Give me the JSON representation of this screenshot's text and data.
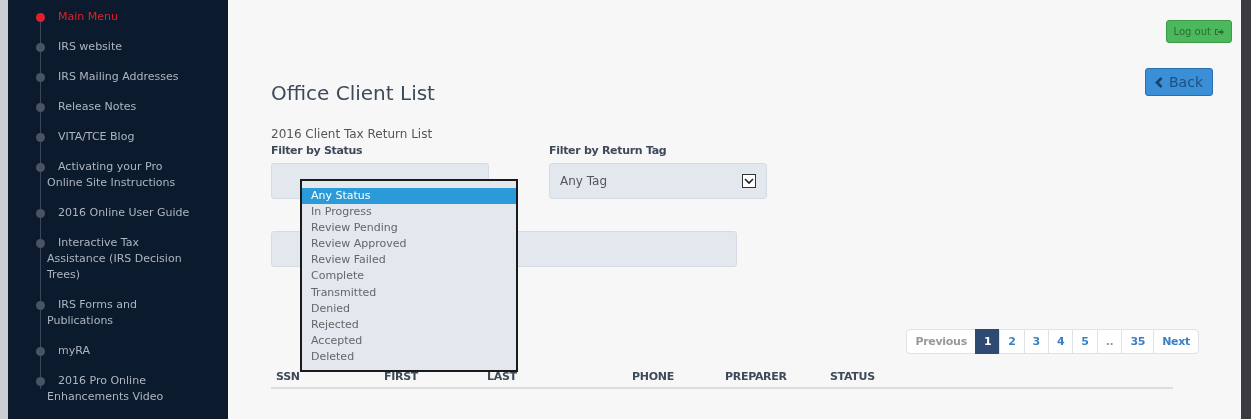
{
  "sidebar": {
    "items": [
      {
        "label": "Main Menu",
        "selected": true
      },
      {
        "label": "IRS website",
        "selected": false
      },
      {
        "label": "IRS Mailing Addresses",
        "selected": false
      },
      {
        "label": "Release Notes",
        "selected": false
      },
      {
        "label": "VITA/TCE Blog",
        "selected": false
      },
      {
        "label": "Activating your Pro Online Site Instructions",
        "selected": false
      },
      {
        "label": "2016 Online User Guide",
        "selected": false
      },
      {
        "label": "Interactive Tax Assistance (IRS Decision Trees)",
        "selected": false
      },
      {
        "label": "IRS Forms and Publications",
        "selected": false
      },
      {
        "label": "myRA",
        "selected": false
      },
      {
        "label": "2016 Pro Online Enhancements Video",
        "selected": false
      }
    ]
  },
  "logout_button": "Log out",
  "back_button": "Back",
  "title": "Office Client List",
  "subtitle": "2016 Client Tax Return List",
  "status_filter": {
    "label": "Filter by Status",
    "expanded": true,
    "options": [
      {
        "label": "Any Status",
        "selected": true
      },
      {
        "label": "In Progress",
        "selected": false
      },
      {
        "label": "Review Pending",
        "selected": false
      },
      {
        "label": "Review Approved",
        "selected": false
      },
      {
        "label": "Review Failed",
        "selected": false
      },
      {
        "label": "Complete",
        "selected": false
      },
      {
        "label": "Transmitted",
        "selected": false
      },
      {
        "label": "Denied",
        "selected": false
      },
      {
        "label": "Rejected",
        "selected": false
      },
      {
        "label": "Accepted",
        "selected": false
      },
      {
        "label": "Deleted",
        "selected": false
      }
    ]
  },
  "tag_filter": {
    "label": "Filter by Return Tag",
    "value": "Any Tag"
  },
  "pagination": [
    {
      "label": "Previous",
      "selected": false,
      "disabled": true
    },
    {
      "label": "1",
      "selected": true,
      "disabled": false
    },
    {
      "label": "2",
      "selected": false,
      "disabled": false
    },
    {
      "label": "3",
      "selected": false,
      "disabled": false
    },
    {
      "label": "4",
      "selected": false,
      "disabled": false
    },
    {
      "label": "5",
      "selected": false,
      "disabled": false
    },
    {
      "label": "..",
      "selected": false,
      "disabled": true
    },
    {
      "label": "35",
      "selected": false,
      "disabled": false
    },
    {
      "label": "Next",
      "selected": false,
      "disabled": false
    }
  ],
  "table": {
    "columns": [
      "SSN",
      "FIRST",
      "LAST",
      "PHONE",
      "PREPARER",
      "STATUS"
    ]
  }
}
